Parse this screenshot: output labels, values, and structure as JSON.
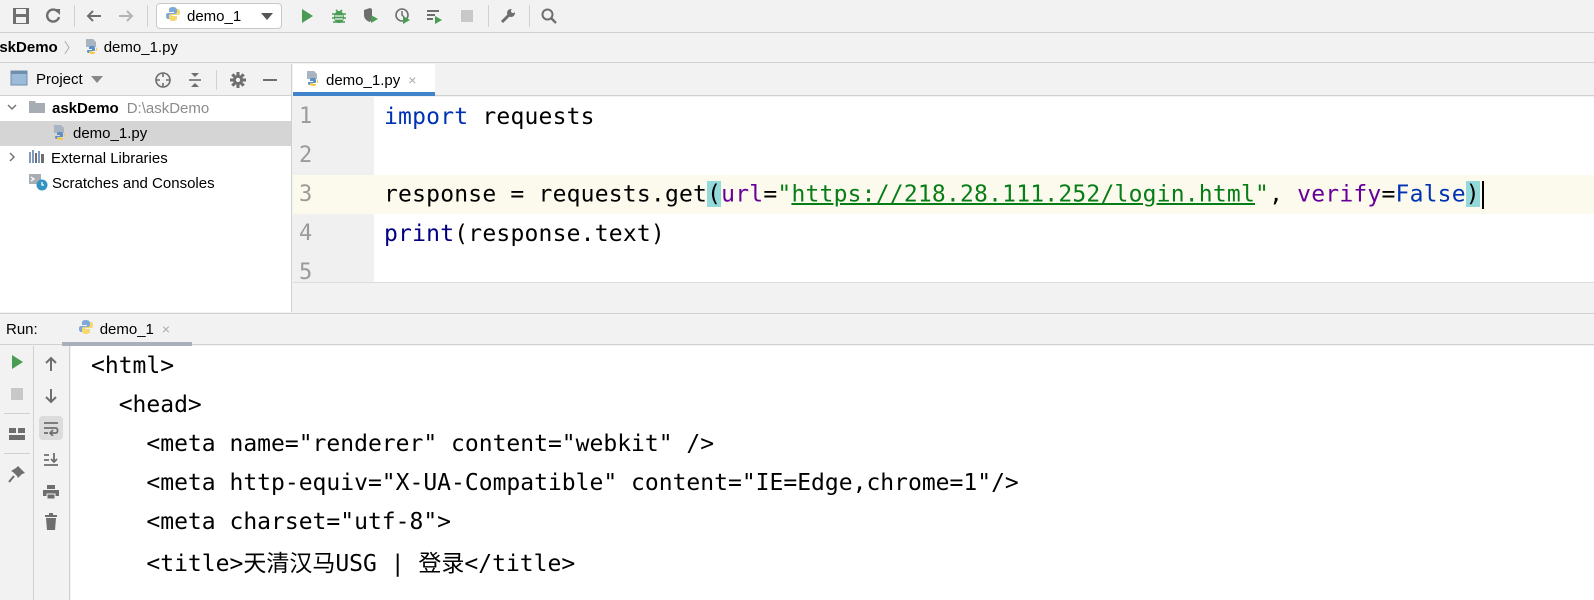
{
  "toolbar": {
    "run_config": "demo_1",
    "icons": [
      "save-icon",
      "sync-icon",
      "back-icon",
      "forward-icon",
      "run-icon",
      "debug-icon",
      "coverage-icon",
      "profile-icon",
      "run-concurrency-icon",
      "stop-icon",
      "settings-wrench-icon",
      "search-icon"
    ]
  },
  "breadcrumb": {
    "root": "askDemo",
    "separator": "〉",
    "file": "demo_1.py"
  },
  "project": {
    "title": "Project",
    "tree": [
      {
        "label": "askDemo",
        "path": "D:\\askDemo",
        "expanded": true,
        "arrow": "⌵"
      },
      {
        "label": "demo_1.py",
        "selected": true
      },
      {
        "label": "External Libraries",
        "arrow": "›"
      },
      {
        "label": "Scratches and Consoles"
      }
    ]
  },
  "editor": {
    "tab_label": "demo_1.py",
    "close": "×",
    "line_numbers": [
      "1",
      "2",
      "3",
      "4",
      "5"
    ],
    "lines": {
      "l1_kw": "import",
      "l1_rest": " requests",
      "l3_a": "response = requests.get",
      "l3_open": "(",
      "l3_param1": "url",
      "l3_eq1": "=",
      "l3_q1": "\"",
      "l3_url": "https://218.28.111.252/login.html",
      "l3_q2": "\"",
      "l3_comma": ", ",
      "l3_param2": "verify",
      "l3_eq2": "=",
      "l3_false": "False",
      "l3_close": ")",
      "l4_builtin": "print",
      "l4_rest": "(response.text)"
    },
    "current_line": 3
  },
  "run": {
    "label": "Run:",
    "tab_label": "demo_1",
    "close": "×",
    "console_lines": [
      "<html>",
      "  <head>",
      "    <meta name=\"renderer\" content=\"webkit\" />",
      "    <meta http-equiv=\"X-UA-Compatible\" content=\"IE=Edge,chrome=1\"/>",
      "    <meta charset=\"utf-8\">",
      "    <title>天清汉马USG | 登录</title>"
    ]
  },
  "colors": {
    "keyword": "#0033b3",
    "builtin": "#000080",
    "param": "#660099",
    "string": "#067d17",
    "brace_highlight": "#93d9d9",
    "run_green": "#499c54",
    "tab_underline": "#4083c9"
  }
}
